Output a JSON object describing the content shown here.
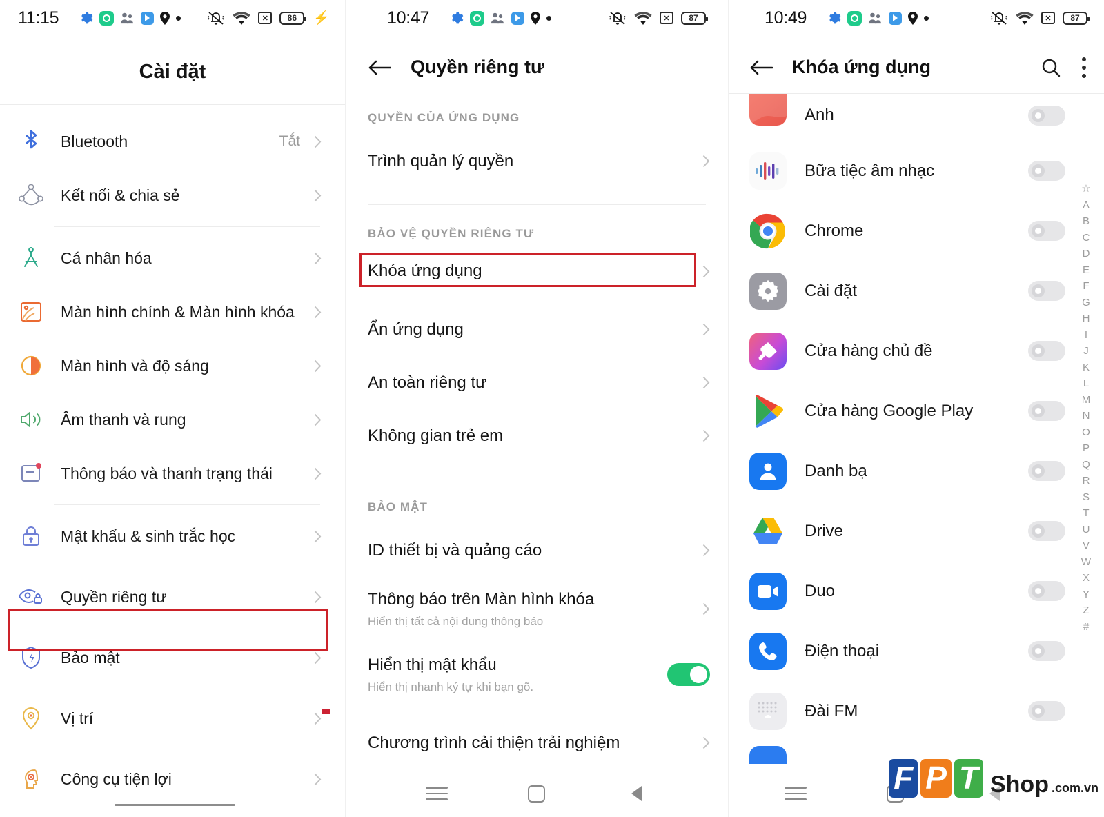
{
  "panel1": {
    "status": {
      "time": "11:15",
      "battery": "86",
      "icons": [
        "gear-icon",
        "record-icon",
        "people-icon",
        "note-icon",
        "location-pin-icon",
        "dot-icon",
        "mute-bell-icon",
        "wifi-icon",
        "no-sim-icon",
        "battery-icon",
        "charging-bolt-icon"
      ]
    },
    "title": "Cài đặt",
    "items": [
      {
        "label": "Bluetooth",
        "value": "Tắt",
        "icon": "bluetooth-icon",
        "highlight": false
      },
      {
        "label": "Kết nối & chia sẻ",
        "value": "",
        "icon": "share-network-icon",
        "highlight": false
      },
      {
        "label": "Cá nhân hóa",
        "value": "",
        "icon": "compass-icon",
        "highlight": false
      },
      {
        "label": "Màn hình chính & Màn hình khóa",
        "value": "",
        "icon": "wallpaper-icon",
        "highlight": false
      },
      {
        "label": "Màn hình và độ sáng",
        "value": "",
        "icon": "brightness-icon",
        "highlight": false
      },
      {
        "label": "Âm thanh và rung",
        "value": "",
        "icon": "speaker-icon",
        "highlight": false
      },
      {
        "label": "Thông báo và thanh trạng thái",
        "value": "",
        "icon": "notification-icon",
        "highlight": false
      },
      {
        "label": "Mật khẩu & sinh trắc học",
        "value": "",
        "icon": "lock-icon",
        "highlight": false
      },
      {
        "label": "Quyền riêng tư",
        "value": "",
        "icon": "privacy-eye-icon",
        "highlight": true
      },
      {
        "label": "Bảo mật",
        "value": "",
        "icon": "shield-icon",
        "highlight": false
      },
      {
        "label": "Vị trí",
        "value": "",
        "icon": "location-icon",
        "highlight": false
      },
      {
        "label": "Công cụ tiện lợi",
        "value": "",
        "icon": "head-gear-icon",
        "highlight": false
      }
    ]
  },
  "panel2": {
    "status": {
      "time": "10:47",
      "battery": "87"
    },
    "title": "Quyền riêng tư",
    "sections": [
      {
        "label": "QUYỀN CỦA ỨNG DỤNG",
        "rows": [
          {
            "title": "Trình quản lý quyền",
            "sub": "",
            "type": "chevron",
            "highlight": false
          }
        ]
      },
      {
        "label": "BẢO VỆ QUYỀN RIÊNG TƯ",
        "rows": [
          {
            "title": "Khóa ứng dụng",
            "sub": "",
            "type": "chevron",
            "highlight": true
          },
          {
            "title": "Ẩn ứng dụng",
            "sub": "",
            "type": "chevron",
            "highlight": false
          },
          {
            "title": "An toàn riêng tư",
            "sub": "",
            "type": "chevron",
            "highlight": false
          },
          {
            "title": "Không gian trẻ em",
            "sub": "",
            "type": "chevron",
            "highlight": false
          }
        ]
      },
      {
        "label": "BẢO MẬT",
        "rows": [
          {
            "title": "ID thiết bị và quảng cáo",
            "sub": "",
            "type": "chevron",
            "highlight": false
          },
          {
            "title": "Thông báo trên Màn hình khóa",
            "sub": "Hiển thị tất cả nội dung thông báo",
            "type": "chevron",
            "highlight": false
          },
          {
            "title": "Hiển thị mật khẩu",
            "sub": "Hiển thị nhanh ký tự khi bạn gõ.",
            "type": "toggle-on",
            "highlight": false
          },
          {
            "title": "Chương trình cải thiện trải nghiệm",
            "sub": "",
            "type": "chevron",
            "highlight": false
          }
        ]
      }
    ]
  },
  "panel3": {
    "status": {
      "time": "10:49",
      "battery": "87"
    },
    "title": "Khóa ứng dụng",
    "actions": [
      "search-icon",
      "overflow-menu-icon"
    ],
    "apps": [
      {
        "name": "Anh",
        "icon": "photos-icon",
        "enabled": false
      },
      {
        "name": "Bữa tiệc âm nhạc",
        "icon": "music-party-icon",
        "enabled": false
      },
      {
        "name": "Chrome",
        "icon": "chrome-icon",
        "enabled": false
      },
      {
        "name": "Cài đặt",
        "icon": "settings-icon",
        "enabled": false
      },
      {
        "name": "Cửa hàng chủ đề",
        "icon": "theme-store-icon",
        "enabled": false
      },
      {
        "name": "Cửa hàng Google Play",
        "icon": "play-store-icon",
        "enabled": false
      },
      {
        "name": "Danh bạ",
        "icon": "contacts-icon",
        "enabled": false
      },
      {
        "name": "Drive",
        "icon": "drive-icon",
        "enabled": false
      },
      {
        "name": "Duo",
        "icon": "duo-icon",
        "enabled": false
      },
      {
        "name": "Điện thoại",
        "icon": "phone-icon",
        "enabled": false
      },
      {
        "name": "Đài FM",
        "icon": "fm-radio-icon",
        "enabled": false
      }
    ],
    "alpha_index": [
      "☆",
      "A",
      "B",
      "C",
      "D",
      "E",
      "F",
      "G",
      "H",
      "I",
      "J",
      "K",
      "L",
      "M",
      "N",
      "O",
      "P",
      "Q",
      "R",
      "S",
      "T",
      "U",
      "V",
      "W",
      "X",
      "Y",
      "Z",
      "#"
    ]
  },
  "navbar": {
    "recents": "recents-icon",
    "home": "home-icon",
    "back": "back-icon"
  },
  "watermark": {
    "f": "F",
    "p": "P",
    "t": "T",
    "shop": "Shop",
    "domain": ".com.vn"
  },
  "colors": {
    "highlight": "#cc2229",
    "toggle_on": "#21c573",
    "accent_blue": "#2f6ee0"
  }
}
